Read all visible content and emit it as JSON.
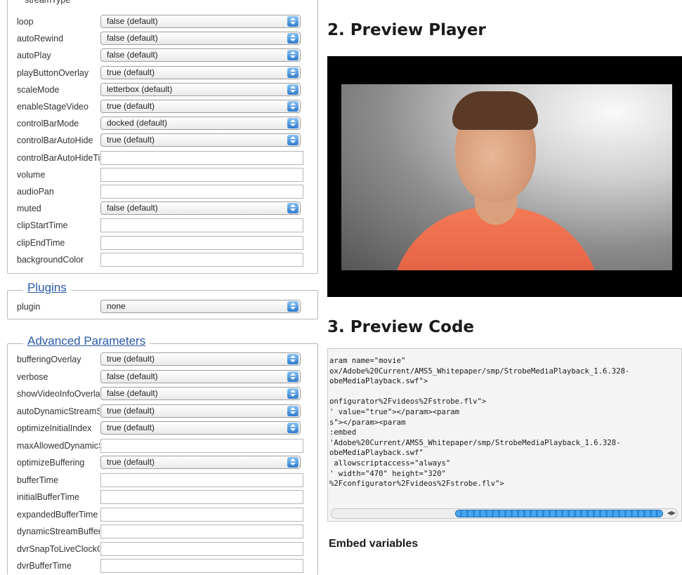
{
  "top_partial_label": "streamType",
  "basic_rows": [
    {
      "label": "loop",
      "type": "select",
      "value": "false (default)"
    },
    {
      "label": "autoRewind",
      "type": "select",
      "value": "false (default)"
    },
    {
      "label": "autoPlay",
      "type": "select",
      "value": "false (default)"
    },
    {
      "label": "playButtonOverlay",
      "type": "select",
      "value": "true (default)"
    },
    {
      "label": "scaleMode",
      "type": "select",
      "value": "letterbox (default)"
    },
    {
      "label": "enableStageVideo",
      "type": "select",
      "value": "true (default)"
    },
    {
      "label": "controlBarMode",
      "type": "select",
      "value": "docked (default)"
    },
    {
      "label": "controlBarAutoHide",
      "type": "select",
      "value": "true (default)"
    },
    {
      "label": "controlBarAutoHideTimeout",
      "type": "text",
      "value": ""
    },
    {
      "label": "volume",
      "type": "text",
      "value": ""
    },
    {
      "label": "audioPan",
      "type": "text",
      "value": ""
    },
    {
      "label": "muted",
      "type": "select",
      "value": "false (default)"
    },
    {
      "label": "clipStartTime",
      "type": "text",
      "value": ""
    },
    {
      "label": "clipEndTime",
      "type": "text",
      "value": ""
    },
    {
      "label": "backgroundColor",
      "type": "text",
      "value": ""
    }
  ],
  "plugins": {
    "legend": "Plugins",
    "rows": [
      {
        "label": "plugin",
        "type": "select",
        "value": "none"
      }
    ]
  },
  "advanced": {
    "legend": "Advanced Parameters",
    "rows": [
      {
        "label": "bufferingOverlay",
        "type": "select",
        "value": "true (default)"
      },
      {
        "label": "verbose",
        "type": "select",
        "value": "false (default)"
      },
      {
        "label": "showVideoInfoOverlay",
        "type": "select",
        "value": "false (default)"
      },
      {
        "label": "autoDynamicStreamSwitch",
        "type": "select",
        "value": "true (default)"
      },
      {
        "label": "optimizeInitialIndex",
        "type": "select",
        "value": "true (default)"
      },
      {
        "label": "maxAllowedDynamicStreamIndex",
        "type": "text",
        "value": ""
      },
      {
        "label": "optimizeBuffering",
        "type": "select",
        "value": "true (default)"
      },
      {
        "label": "bufferTime",
        "type": "text",
        "value": ""
      },
      {
        "label": "initialBufferTime",
        "type": "text",
        "value": ""
      },
      {
        "label": "expandedBufferTime",
        "type": "text",
        "value": ""
      },
      {
        "label": "dynamicStreamBufferTime",
        "type": "text",
        "value": ""
      },
      {
        "label": "dvrSnapToLiveClockOffset",
        "type": "text",
        "value": ""
      },
      {
        "label": "dvrBufferTime",
        "type": "text",
        "value": ""
      }
    ]
  },
  "preview_player": {
    "heading": "2. Preview Player"
  },
  "preview_code": {
    "heading": "3. Preview Code",
    "code": "aram name=\"movie\"\nox/Adobe%20Current/AMS5_Whitepaper/smp/StrobeMediaPlayback_1.6.328-\nobeMediaPlayback.swf\">\n\nonfigurator%2Fvideos%2Fstrobe.flv\">\n' value=\"true\"></param><param\ns\"></param><param\n:embed\n'Adobe%20Current/AMS5_Whitepaper/smp/StrobeMediaPlayback_1.6.328-\nobeMediaPlayback.swf\"\n allowscriptaccess=\"always\"\n' width=\"470\" height=\"320\"\n%2Fconfigurator%2Fvideos%2Fstrobe.flv\">"
  },
  "embed_variables": {
    "heading": "Embed variables"
  },
  "icons": {
    "select_arrow": "updown-arrows-icon",
    "scroll_left": "arrow-left-icon",
    "scroll_right": "arrow-right-icon"
  },
  "colors": {
    "link": "#2a5aa8",
    "select_arrow": "#2e7bcf",
    "player_bg": "#000000",
    "shirt": "#e8603f"
  }
}
